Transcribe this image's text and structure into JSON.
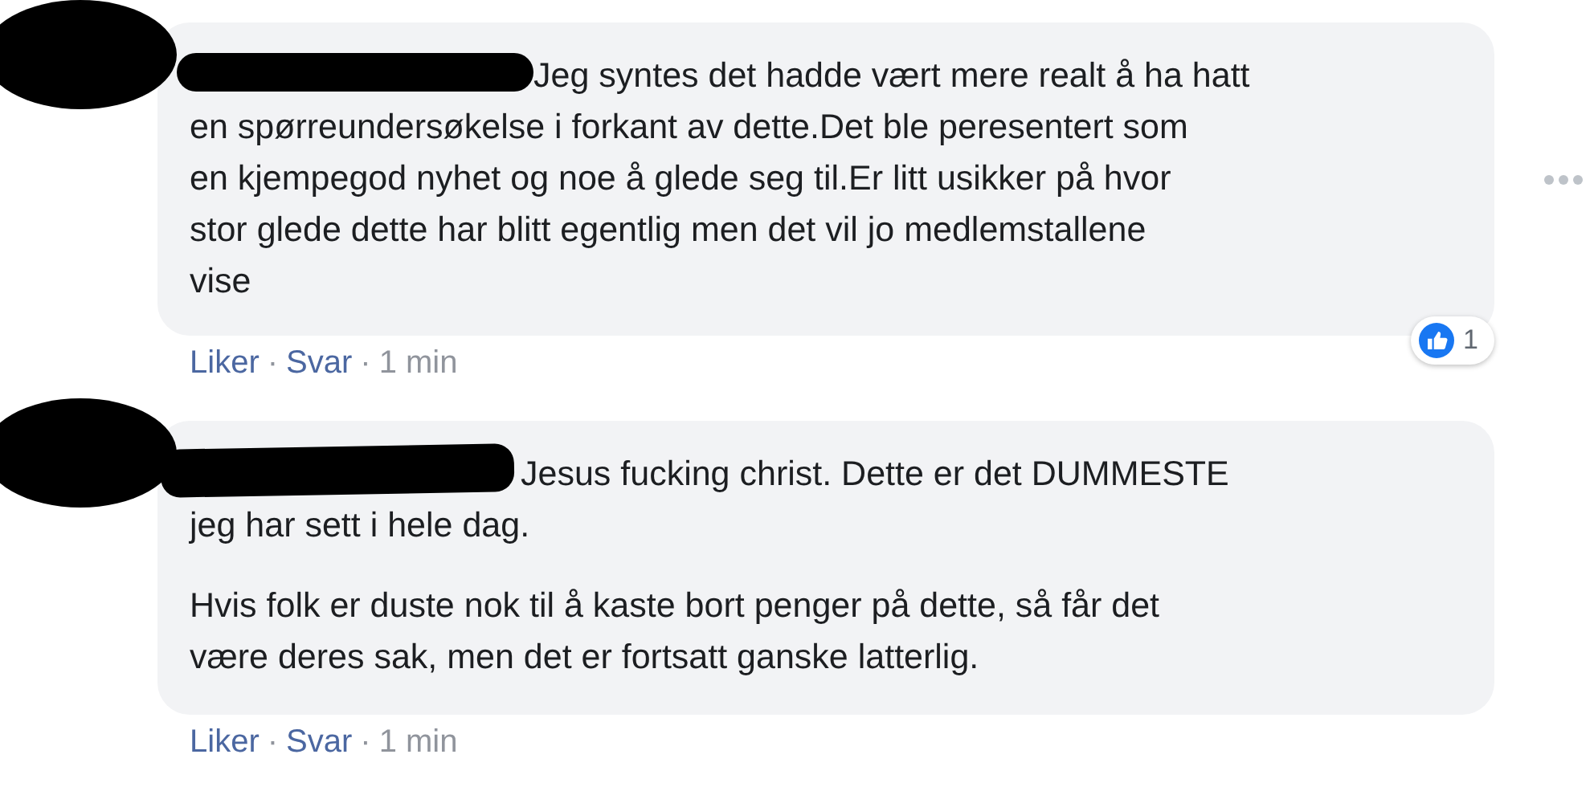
{
  "comments": [
    {
      "paragraphs": [
        {
          "lines": [
            "Jeg syntes det hadde vært mere realt å ha hatt",
            "en spørreundersøkelse i forkant av dette.Det ble peresentert som",
            "en kjempegod nyhet og noe å glede seg til.Er litt usikker på hvor",
            "stor glede dette har blitt egentlig men det vil jo medlemstallene",
            "vise"
          ]
        }
      ],
      "reaction_count": "1",
      "actions": {
        "like": "Liker",
        "sep1": "·",
        "reply": "Svar",
        "sep2": "·",
        "time": "1 min"
      }
    },
    {
      "paragraphs": [
        {
          "lines": [
            "Jesus fucking christ. Dette er det DUMMESTE",
            "jeg har sett i hele dag."
          ]
        },
        {
          "lines": [
            "Hvis folk er duste nok til å kaste bort penger på dette, så får det",
            "være deres sak, men det er fortsatt ganske latterlig."
          ]
        }
      ],
      "actions": {
        "like": "Liker",
        "sep1": "·",
        "reply": "Svar",
        "sep2": "·",
        "time": "1 min"
      }
    }
  ]
}
